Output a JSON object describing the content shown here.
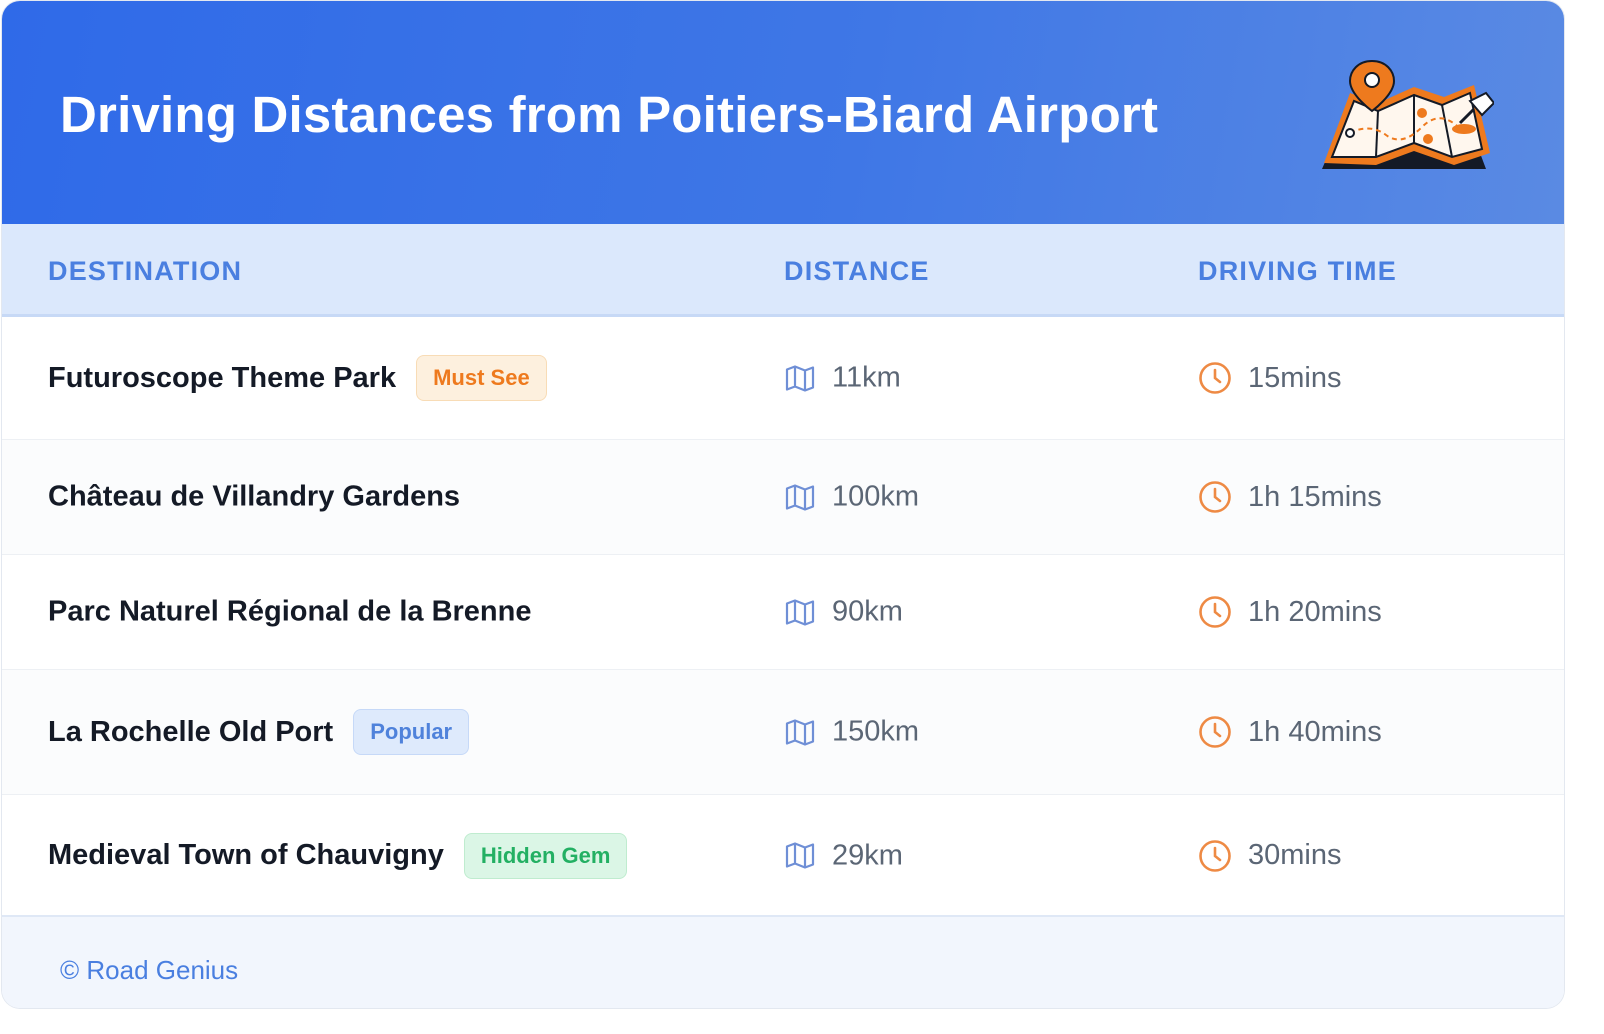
{
  "header": {
    "title": "Driving Distances from Poitiers-Biard Airport",
    "illustration_icon": "map-with-pins-illustration"
  },
  "table": {
    "columns": [
      "DESTINATION",
      "DISTANCE",
      "DRIVING TIME"
    ],
    "distance_icon": "map-icon",
    "time_icon": "clock-icon",
    "rows": [
      {
        "destination": "Futuroscope Theme Park",
        "badge": "Must See",
        "badge_color": "#ee7a1e",
        "distance": "11km",
        "time": "15mins"
      },
      {
        "destination": "Château de Villandry Gardens",
        "badge": "",
        "distance": "100km",
        "time": "1h 15mins"
      },
      {
        "destination": "Parc Naturel Régional de la Brenne",
        "badge": "",
        "distance": "90km",
        "time": "1h 20mins"
      },
      {
        "destination": "La Rochelle Old Port",
        "badge": "Popular",
        "badge_color": "#4f82db",
        "distance": "150km",
        "time": "1h 40mins"
      },
      {
        "destination": "Medieval Town of Chauvigny",
        "badge": "Hidden Gem",
        "badge_color": "#23b063",
        "distance": "29km",
        "time": "30mins"
      }
    ]
  },
  "footer": {
    "text": "© Road Genius"
  },
  "colors": {
    "header_bg": "#2f6ae8",
    "accent": "#4a7fe0",
    "clock": "#ee8a44"
  }
}
